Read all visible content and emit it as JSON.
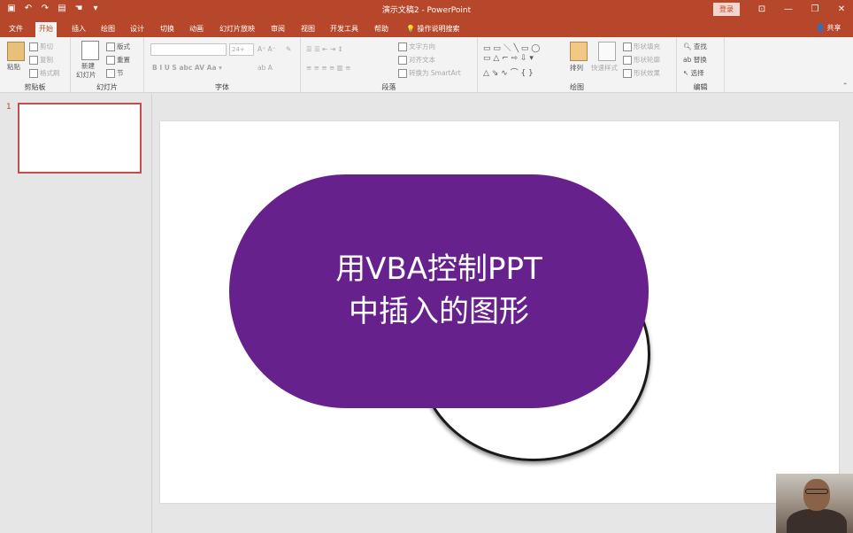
{
  "window": {
    "title": "演示文稿2 - PowerPoint",
    "login_label": "登录",
    "share_label": "共享"
  },
  "tabs": [
    {
      "label": "文件",
      "active": false
    },
    {
      "label": "开始",
      "active": true
    },
    {
      "label": "插入",
      "active": false
    },
    {
      "label": "绘图",
      "active": false
    },
    {
      "label": "设计",
      "active": false
    },
    {
      "label": "切换",
      "active": false
    },
    {
      "label": "动画",
      "active": false
    },
    {
      "label": "幻灯片放映",
      "active": false
    },
    {
      "label": "审阅",
      "active": false
    },
    {
      "label": "视图",
      "active": false
    },
    {
      "label": "开发工具",
      "active": false
    },
    {
      "label": "帮助",
      "active": false
    },
    {
      "label": "操作说明搜索",
      "active": false
    }
  ],
  "ribbon": {
    "clipboard": {
      "label": "剪贴板",
      "paste": "粘贴",
      "cut": "剪切",
      "copy": "复制",
      "format_painter": "格式刷"
    },
    "slides": {
      "label": "幻灯片",
      "new_slide": "新建",
      "new_slide_2": "幻灯片",
      "layout": "版式",
      "reset": "重置",
      "section": "节"
    },
    "font": {
      "label": "字体",
      "size_value": "24+"
    },
    "paragraph": {
      "label": "段落",
      "text_direction": "文字方向",
      "align_text": "对齐文本",
      "convert_smartart": "转换为 SmartArt"
    },
    "drawing": {
      "label": "绘图",
      "arrange": "排列",
      "quick_styles": "快速样式",
      "shape_fill": "形状填充",
      "shape_outline": "形状轮廓",
      "shape_effects": "形状效果"
    },
    "editing": {
      "label": "编辑",
      "find": "查找",
      "replace": "替换",
      "select": "选择"
    }
  },
  "thumbnails": [
    {
      "number": "1"
    }
  ],
  "slide": {
    "shape_text_line1": "用VBA控制PPT",
    "shape_text_line2": "中插入的图形",
    "pill_color": "#67218c"
  }
}
